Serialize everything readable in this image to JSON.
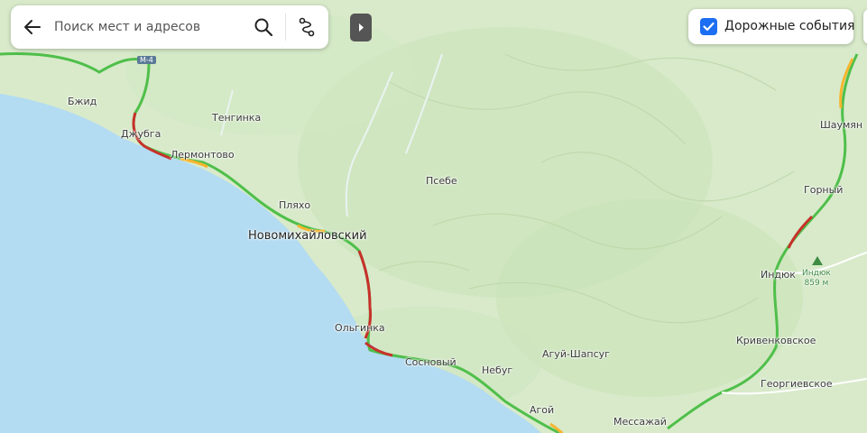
{
  "search": {
    "placeholder": "Поиск мест и адресов",
    "back_icon": "arrow-left-icon",
    "search_icon": "magnifier-icon",
    "route_icon": "route-icon"
  },
  "panel_toggle": {
    "icon": "chevron-right-icon"
  },
  "traffic": {
    "label": "Дорожные события",
    "checked": true,
    "accent": "#1c6ef2"
  },
  "road_shield": "М-4",
  "places": {
    "bzhid": "Бжид",
    "dzhubga": "Джубга",
    "tenginka": "Тенгинка",
    "lermontovo": "Лермонтово",
    "plyakho": "Пляхо",
    "novomikhaylovskiy": "Новомихайловский",
    "psebe": "Псебе",
    "olginka": "Ольгинка",
    "sosnovyy": "Сосновый",
    "nebug": "Небуг",
    "aguy_shapsug": "Агуй-Шапсуг",
    "agoy": "Агой",
    "messazhay": "Мессажай",
    "shaumyan": "Шаумян",
    "gornyy": "Горный",
    "indyuk": "Индюк",
    "krivenkovskoe": "Кривенковское",
    "georgievskoe": "Георгиевское"
  },
  "peak": {
    "name": "Индюк",
    "elevation": "859 м"
  },
  "colors": {
    "sea": "#b3dbf2",
    "land": "#d7eac9",
    "road_free": "#4fbf4a",
    "road_slow": "#f6b52e",
    "road_jam": "#c8312b"
  }
}
